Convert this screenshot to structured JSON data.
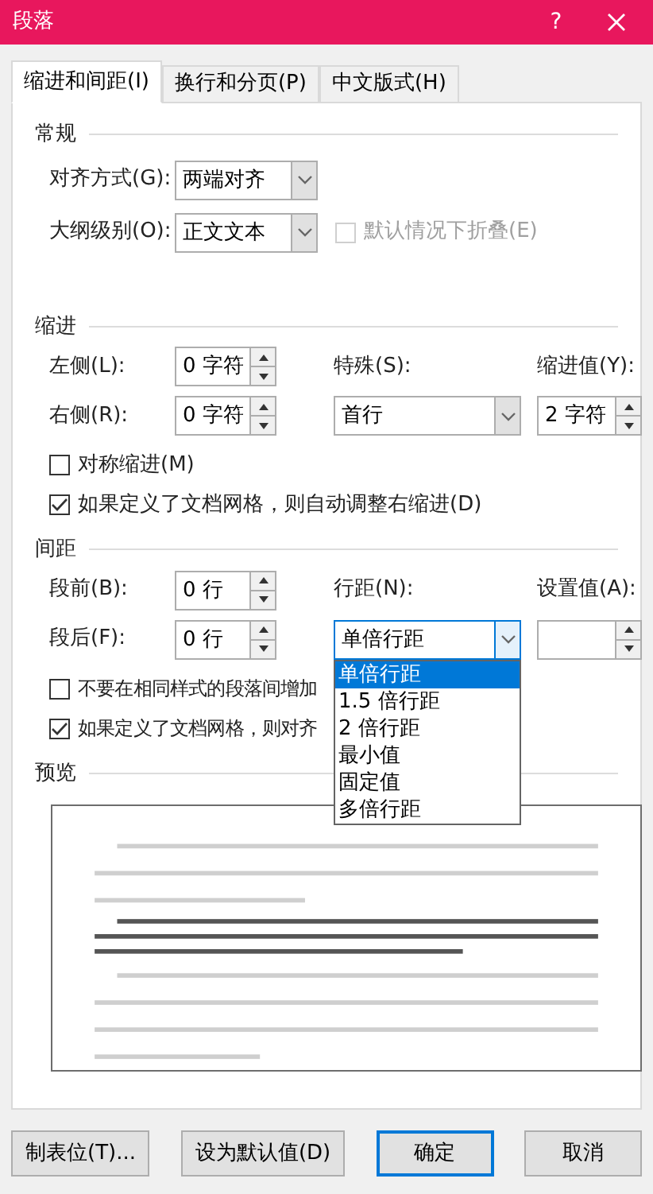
{
  "window": {
    "title": "段落",
    "help": "?"
  },
  "tabs": [
    {
      "label": "缩进和间距(I)",
      "selected": true
    },
    {
      "label": "换行和分页(P)",
      "selected": false
    },
    {
      "label": "中文版式(H)",
      "selected": false
    }
  ],
  "general": {
    "heading": "常规",
    "alignment": {
      "label": "对齐方式(G):",
      "value": "两端对齐"
    },
    "outline": {
      "label": "大纲级别(O):",
      "value": "正文文本"
    },
    "collapse": {
      "label": "默认情况下折叠(E)",
      "checked": false,
      "disabled": true
    }
  },
  "indent": {
    "heading": "缩进",
    "left": {
      "label": "左侧(L):",
      "value": "0 字符"
    },
    "right": {
      "label": "右侧(R):",
      "value": "0 字符"
    },
    "special": {
      "label": "特殊(S):",
      "value": "首行"
    },
    "by": {
      "label": "缩进值(Y):",
      "value": "2 字符"
    },
    "checkboxes": [
      {
        "label": "对称缩进(M)",
        "checked": false
      },
      {
        "label": "如果定义了文档网格，则自动调整右缩进(D)",
        "checked": true
      }
    ]
  },
  "spacing": {
    "heading": "间距",
    "before": {
      "label": "段前(B):",
      "value": "0 行"
    },
    "after": {
      "label": "段后(F):",
      "value": "0 行"
    },
    "line_spacing": {
      "label": "行距(N):",
      "value": "单倍行距",
      "expanded": true,
      "options": [
        {
          "label": "单倍行距",
          "selected": true
        },
        {
          "label": "1.5 倍行距",
          "selected": false
        },
        {
          "label": "2 倍行距",
          "selected": false
        },
        {
          "label": "最小值",
          "selected": false
        },
        {
          "label": "固定值",
          "selected": false
        },
        {
          "label": "多倍行距",
          "selected": false
        }
      ]
    },
    "at": {
      "label": "设置值(A):"
    },
    "checkboxes": [
      {
        "label": "不要在相同样式的段落间增加",
        "checked": false
      },
      {
        "label": "如果定义了文档网格，则对齐",
        "checked": true
      }
    ]
  },
  "preview": {
    "heading": "预览"
  },
  "buttons": [
    {
      "label": "制表位(T)...",
      "default": false
    },
    {
      "label": "设为默认值(D)",
      "default": false
    },
    {
      "label": "确定",
      "default": true
    },
    {
      "label": "取消",
      "default": false
    }
  ]
}
